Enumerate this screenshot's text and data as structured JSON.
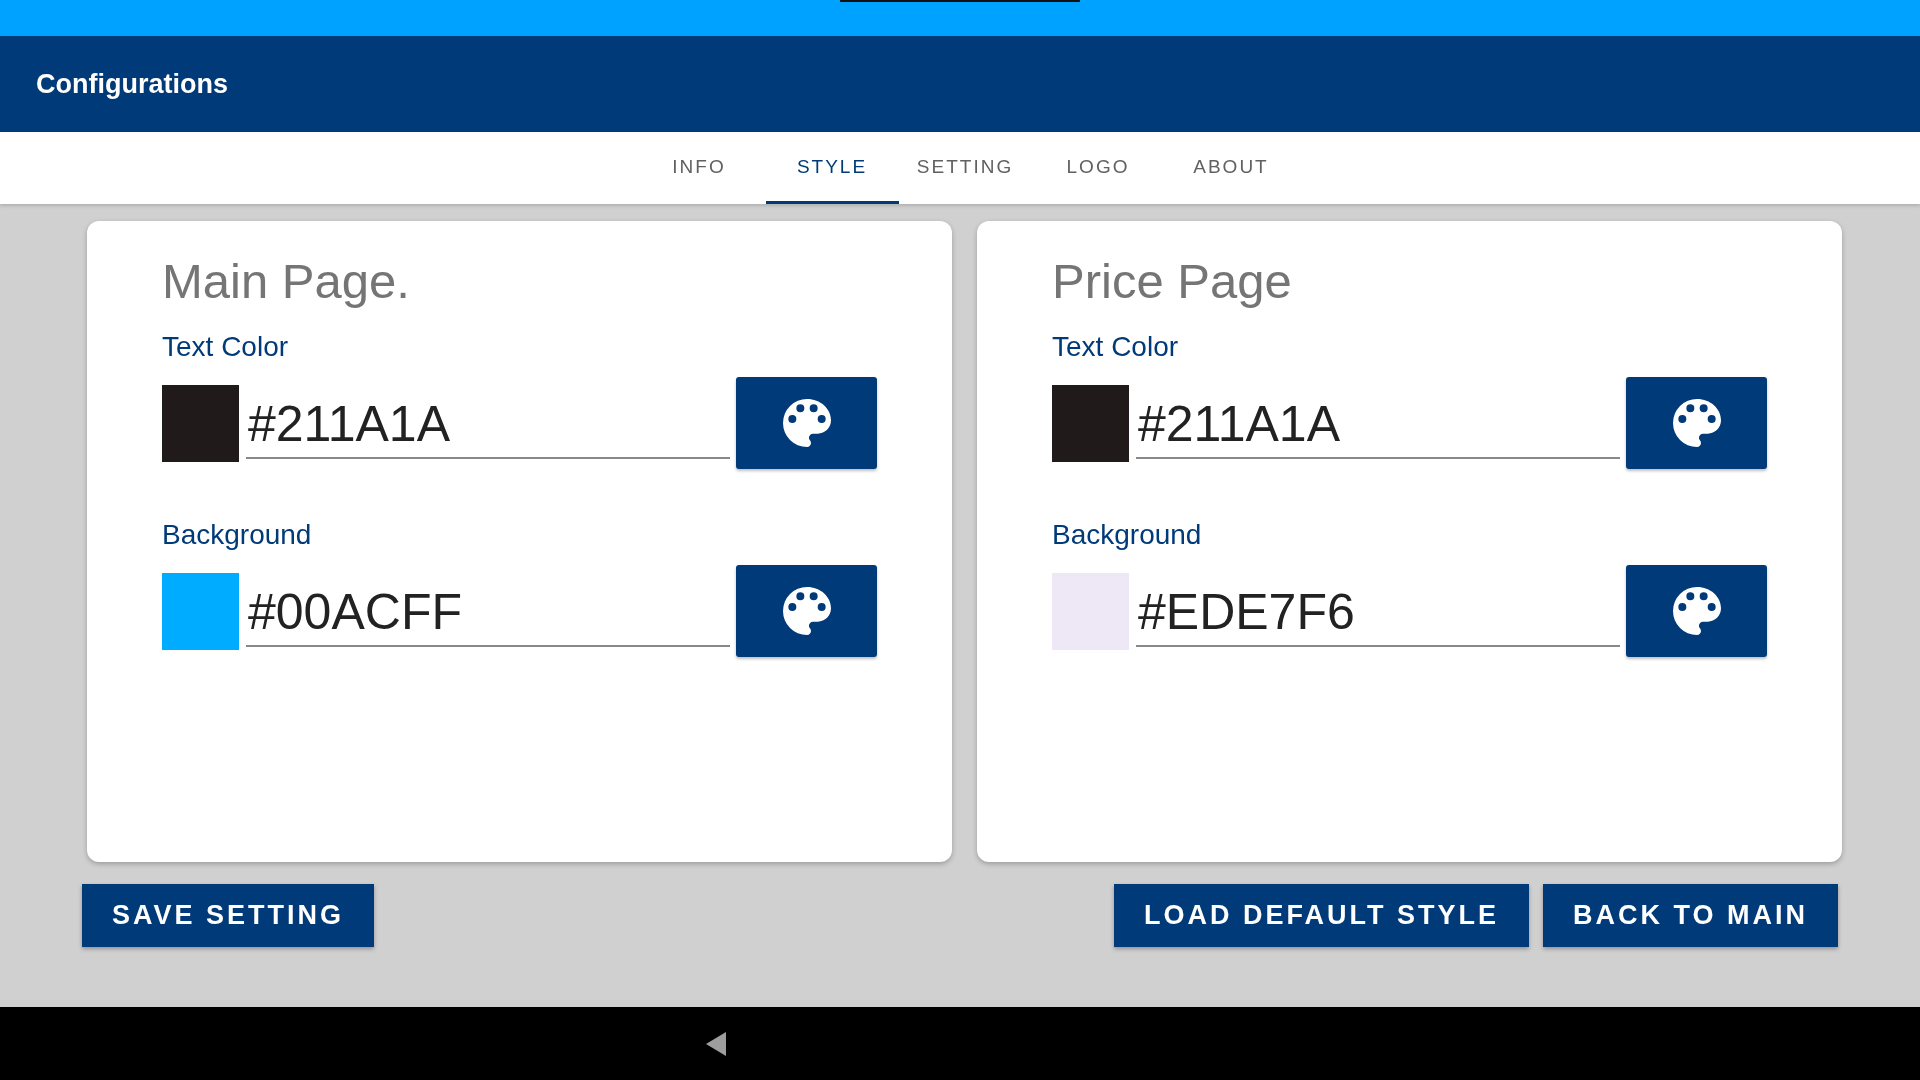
{
  "app_bar": {
    "title": "Configurations"
  },
  "tabs": [
    {
      "label": "INFO",
      "selected": false
    },
    {
      "label": "STYLE",
      "selected": true
    },
    {
      "label": "SETTING",
      "selected": false
    },
    {
      "label": "LOGO",
      "selected": false
    },
    {
      "label": "ABOUT",
      "selected": false
    }
  ],
  "panels": [
    {
      "title": "Main Page.",
      "fields": [
        {
          "label": "Text Color",
          "value": "#211A1A",
          "color": "#211a1a"
        },
        {
          "label": "Background",
          "value": "#00ACFF",
          "color": "#00acff"
        }
      ]
    },
    {
      "title": "Price Page",
      "fields": [
        {
          "label": "Text Color",
          "value": "#211A1A",
          "color": "#211a1a"
        },
        {
          "label": "Background",
          "value": "#EDE7F6",
          "color": "#ede7f6"
        }
      ]
    }
  ],
  "buttons": [
    {
      "label": "SAVE SETTING",
      "kind": "left"
    },
    {
      "label": "LOAD DEFAULT STYLE",
      "kind": "right"
    },
    {
      "label": "BACK TO MAIN",
      "kind": "right"
    }
  ]
}
